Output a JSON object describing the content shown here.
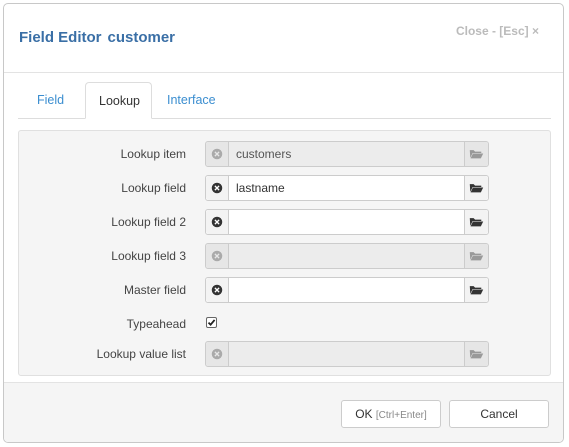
{
  "dialog": {
    "title_prefix": "Field Editor",
    "title_name": "customer",
    "close_label": "Close - [Esc] ×"
  },
  "tabs": [
    {
      "label": "Field",
      "active": false
    },
    {
      "label": "Lookup",
      "active": true
    },
    {
      "label": "Interface",
      "active": false
    }
  ],
  "form": {
    "lookup_item": {
      "label": "Lookup item",
      "value": "customers",
      "disabled": true
    },
    "lookup_field": {
      "label": "Lookup field",
      "value": "lastname",
      "disabled": false
    },
    "lookup_field_2": {
      "label": "Lookup field 2",
      "value": "",
      "disabled": false
    },
    "lookup_field_3": {
      "label": "Lookup field 3",
      "value": "",
      "disabled": true
    },
    "master_field": {
      "label": "Master field",
      "value": "",
      "disabled": false
    },
    "typeahead": {
      "label": "Typeahead",
      "checked": true
    },
    "lookup_value_list": {
      "label": "Lookup value list",
      "value": "",
      "disabled": true
    }
  },
  "footer": {
    "ok_label": "OK",
    "ok_hint": "[Ctrl+Enter]",
    "cancel_label": "Cancel"
  },
  "icons": {
    "clear": "clear-circle-icon",
    "browse": "folder-open-icon",
    "check": "checkmark-icon"
  },
  "colors": {
    "title": "#3a6fa6",
    "tab_link": "#3b8ed0",
    "panel_bg": "#f5f5f5"
  }
}
